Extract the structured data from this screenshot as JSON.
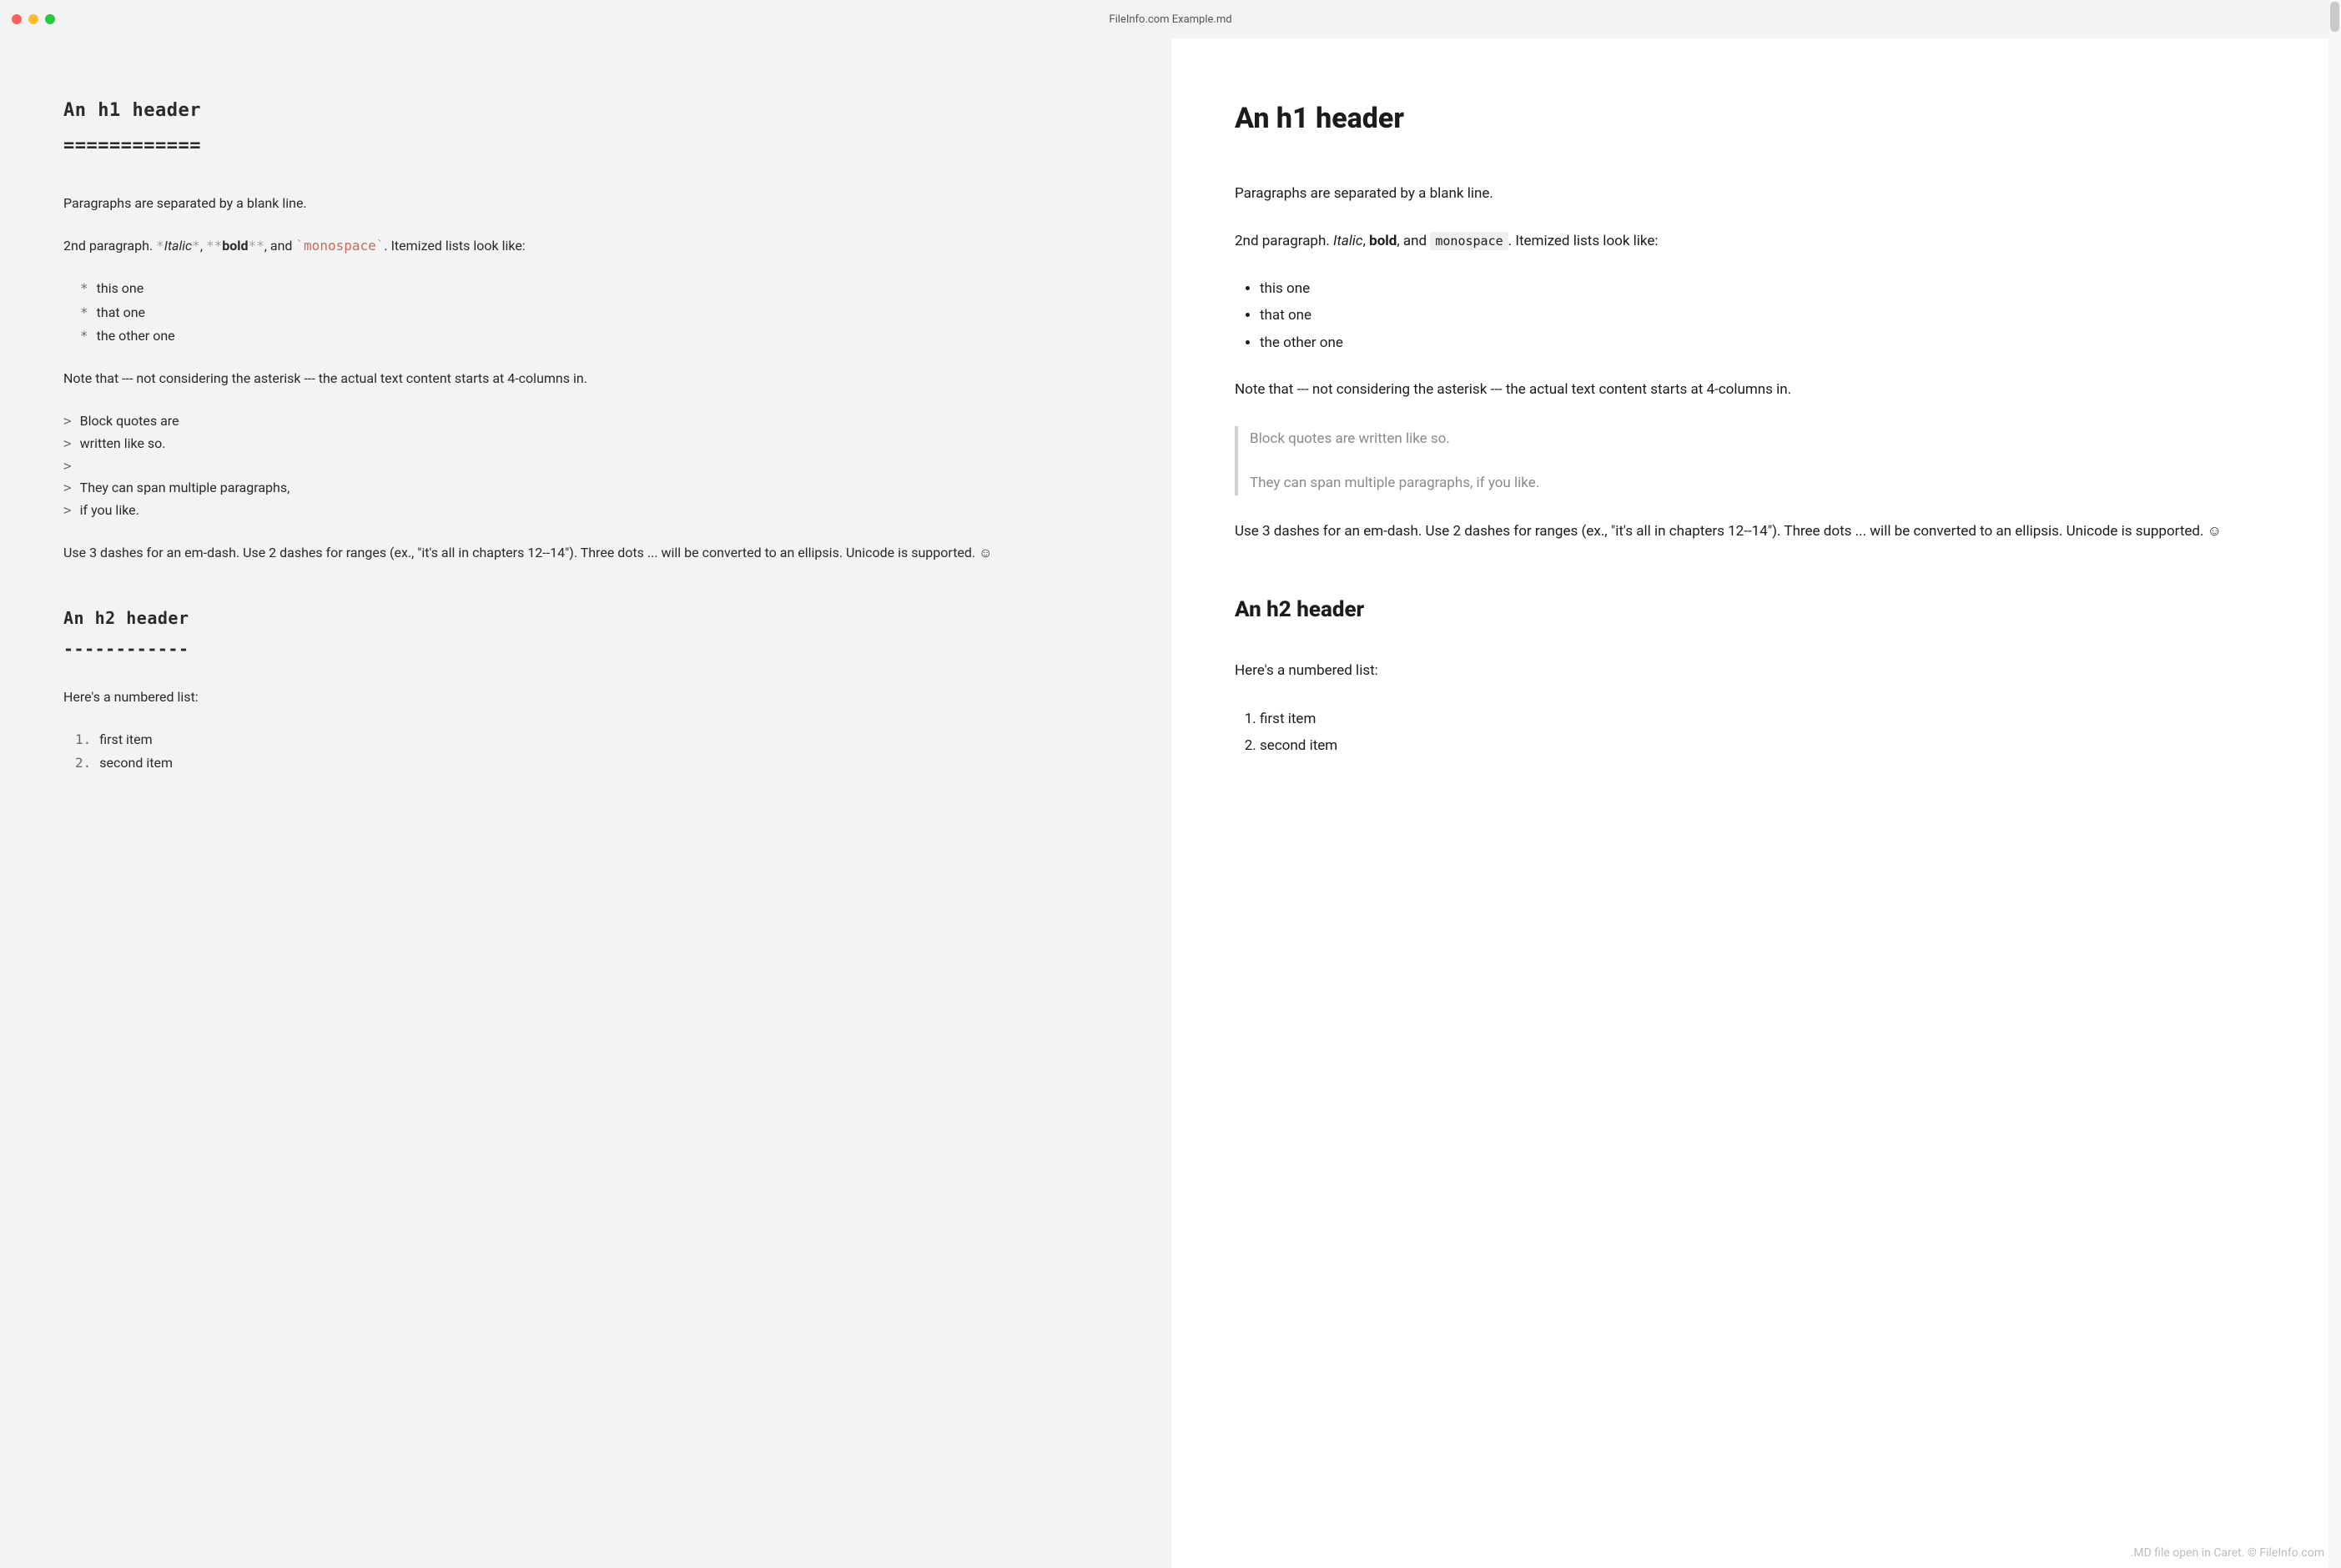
{
  "window": {
    "title": "FileInfo.com Example.md"
  },
  "source": {
    "h1": "An h1 header",
    "h1_underline": "============",
    "p1": "Paragraphs are separated by a blank line.",
    "p2_prefix": "2nd paragraph. ",
    "italic_marker": "*",
    "italic_text": "Italic",
    "comma1": ", ",
    "bold_marker": "**",
    "bold_text": "bold",
    "comma2": ", and ",
    "code_marker": "`",
    "code_text": "monospace",
    "p2_suffix": ". Itemized lists look like:",
    "bullets": [
      "this one",
      "that one",
      "the other one"
    ],
    "note": "Note that --- not considering the asterisk --- the actual text content starts at 4-columns in.",
    "quotes": [
      "Block quotes are",
      "written like so.",
      "",
      "They can span multiple paragraphs,",
      "if you like."
    ],
    "p3": "Use 3 dashes for an em-dash. Use 2 dashes for ranges (ex., \"it's all in chapters 12--14\"). Three dots ... will be converted to an ellipsis. Unicode is supported. ☺",
    "h2": "An h2 header",
    "h2_underline": "------------",
    "p4": "Here's a numbered list:",
    "olist": [
      "first item",
      "second item"
    ]
  },
  "preview": {
    "h1": "An h1 header",
    "p1": "Paragraphs are separated by a blank line.",
    "p2_prefix": "2nd paragraph. ",
    "italic": "Italic",
    "comma1": ", ",
    "bold": "bold",
    "comma2": ", and ",
    "code": "monospace",
    "p2_suffix": ". Itemized lists look like:",
    "bullets": [
      "this one",
      "that one",
      "the other one"
    ],
    "note": "Note that --- not considering the asterisk --- the actual text content starts at 4-columns in.",
    "quote_p1": "Block quotes are written like so.",
    "quote_p2": "They can span multiple paragraphs, if you like.",
    "p3": "Use 3 dashes for an em-dash. Use 2 dashes for ranges (ex., \"it's all in chapters 12--14\"). Three dots ... will be converted to an ellipsis. Unicode is supported. ☺",
    "h2": "An h2 header",
    "p4": "Here's a numbered list:",
    "olist": [
      "first item",
      "second item"
    ]
  },
  "footer": ".MD file open in Caret. © FileInfo.com"
}
